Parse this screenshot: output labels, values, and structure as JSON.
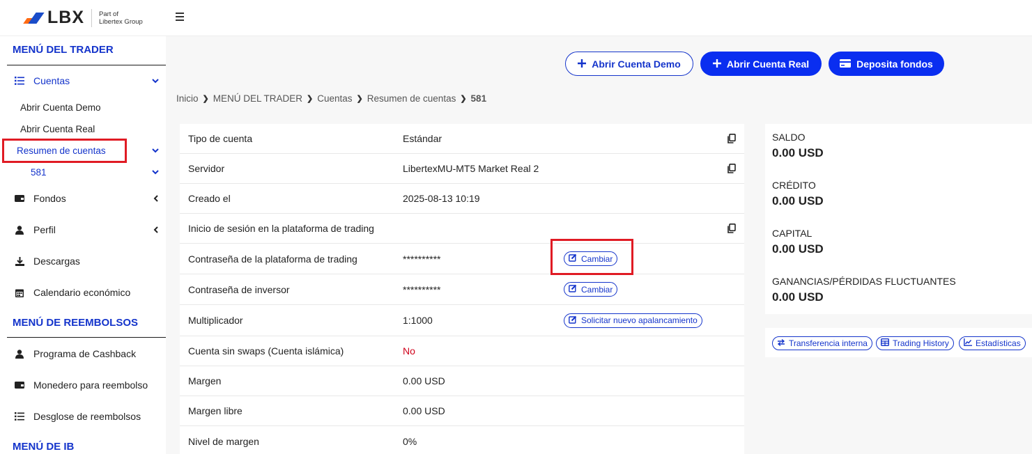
{
  "brand": {
    "name": "LBX",
    "subtitle_line1": "Part of",
    "subtitle_line2": "Libertex Group",
    "accent_orange": "#ff6a13",
    "accent_blue": "#1434cb"
  },
  "sidebar": {
    "trader_heading": "MENÚ DEL TRADER",
    "accounts": {
      "label": "Cuentas",
      "icon": "list-icon",
      "expanded": true
    },
    "accounts_sub": [
      "Abrir Cuenta Demo",
      "Abrir Cuenta Real",
      "Resumen de cuentas"
    ],
    "account_number": "581",
    "funds": {
      "label": "Fondos",
      "icon": "wallet-icon"
    },
    "profile": {
      "label": "Perfil",
      "icon": "user-icon"
    },
    "downloads": {
      "label": "Descargas",
      "icon": "download-icon"
    },
    "calendar": {
      "label": "Calendario económico",
      "icon": "calendar-icon"
    },
    "refund_heading": "MENÚ DE REEMBOLSOS",
    "cashback": {
      "label": "Programa de Cashback",
      "icon": "user-icon"
    },
    "wallet": {
      "label": "Monedero para reembolso",
      "icon": "wallet-icon"
    },
    "breakdown": {
      "label": "Desglose de reembolsos",
      "icon": "list-icon"
    },
    "ib_heading": "MENÚ DE IB"
  },
  "actions": {
    "demo": "Abrir Cuenta Demo",
    "real": "Abrir Cuenta Real",
    "deposit": "Deposita fondos"
  },
  "breadcrumb": [
    "Inicio",
    "MENÚ DEL TRADER",
    "Cuentas",
    "Resumen de cuentas",
    "581"
  ],
  "details": [
    {
      "key": "Tipo de cuenta",
      "value": "Estándar",
      "copy": true
    },
    {
      "key": "Servidor",
      "value": "LibertexMU-MT5 Market Real 2",
      "copy": true
    },
    {
      "key": "Creado el",
      "value": "2025-08-13 10:19"
    },
    {
      "key": "Inicio de sesión en la plataforma de trading",
      "value": "",
      "copy": true
    },
    {
      "key": "Contraseña de la plataforma de trading",
      "value": "**********",
      "action": "Cambiar"
    },
    {
      "key": "Contraseña de inversor",
      "value": "**********",
      "action": "Cambiar"
    },
    {
      "key": "Multiplicador",
      "value": "1:1000",
      "action": "Solicitar nuevo apalancamiento"
    },
    {
      "key": "Cuenta sin swaps (Cuenta islámica)",
      "value": "No"
    },
    {
      "key": "Margen",
      "value": "0.00 USD"
    },
    {
      "key": "Margen libre",
      "value": "0.00 USD"
    },
    {
      "key": "Nivel de margen",
      "value": "0%"
    }
  ],
  "balances": [
    {
      "label": "SALDO",
      "value": "0.00 USD"
    },
    {
      "label": "CRÉDITO",
      "value": "0.00 USD"
    },
    {
      "label": "CAPITAL",
      "value": "0.00 USD"
    },
    {
      "label": "GANANCIAS/PÉRDIDAS FLUCTUANTES",
      "value": "0.00 USD"
    }
  ],
  "links": {
    "transfer": "Transferencia interna",
    "history": "Trading History",
    "stats": "Estadísticas"
  }
}
